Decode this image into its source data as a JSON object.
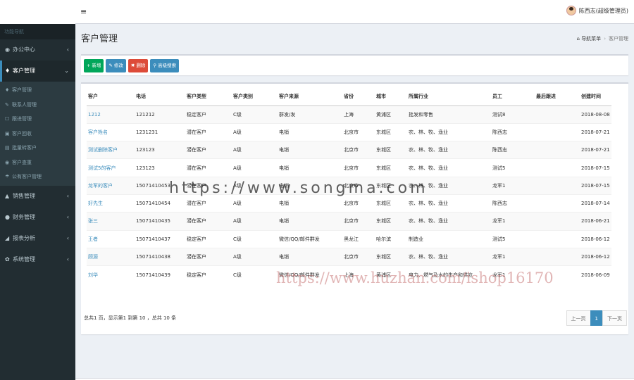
{
  "header": {
    "menu_toggle": "≡",
    "user_name": "陈西志(超级管理员)"
  },
  "sidebar": {
    "nav_header": "功能导航",
    "items": [
      {
        "icon": "◉",
        "label": "办公中心",
        "chevron": "‹"
      },
      {
        "icon": "♦",
        "label": "客户管理",
        "chevron": "⌄"
      },
      {
        "icon": "▲",
        "label": "销售管理",
        "chevron": "‹"
      },
      {
        "icon": "●",
        "label": "财务管理",
        "chevron": "‹"
      },
      {
        "icon": "◢",
        "label": "报表分析",
        "chevron": "‹"
      },
      {
        "icon": "✿",
        "label": "系统管理",
        "chevron": "‹"
      }
    ],
    "submenu": [
      {
        "icon": "♦",
        "label": "客户管理"
      },
      {
        "icon": "✎",
        "label": "联系人管理"
      },
      {
        "icon": "☐",
        "label": "跟进管理"
      },
      {
        "icon": "▣",
        "label": "客户回收"
      },
      {
        "icon": "▤",
        "label": "批量转客户"
      },
      {
        "icon": "◉",
        "label": "客户查重"
      },
      {
        "icon": "☂",
        "label": "公有客户管理"
      }
    ]
  },
  "page": {
    "title": "客户管理",
    "breadcrumb_home": "导航菜单",
    "breadcrumb_sep": "›",
    "breadcrumb_current": "客户管理"
  },
  "toolbar": {
    "add_label": "新增",
    "edit_label": "修改",
    "delete_label": "删除",
    "search_label": "高级搜索"
  },
  "table": {
    "headers": [
      "客户",
      "电话",
      "客户类型",
      "客户类别",
      "客户来源",
      "省份",
      "城市",
      "所属行业",
      "员工",
      "最后跟进",
      "创建时间"
    ],
    "rows": [
      [
        "1212",
        "121212",
        "稳定客户",
        "C级",
        "群发/发",
        "上海",
        "黄浦区",
        "批发和零售",
        "测试8",
        "",
        "2018-08-08"
      ],
      [
        "客户姓名",
        "1231231",
        "潜在客户",
        "A级",
        "电销",
        "北京市",
        "东城区",
        "农、林、牧、渔业",
        "陈西志",
        "",
        "2018-07-21"
      ],
      [
        "测试删除客户",
        "123123",
        "潜在客户",
        "A级",
        "电销",
        "北京市",
        "东城区",
        "农、林、牧、渔业",
        "陈西志",
        "",
        "2018-07-21"
      ],
      [
        "测试5的客户",
        "123123",
        "潜在客户",
        "A级",
        "电销",
        "北京市",
        "东城区",
        "农、林、牧、渔业",
        "测试5",
        "",
        "2018-07-15"
      ],
      [
        "龙军的客户",
        "15071410453",
        "潜在客户",
        "A级",
        "电销",
        "北京市",
        "东城区",
        "农、林、牧、渔业",
        "龙军1",
        "",
        "2018-07-15"
      ],
      [
        "好先生",
        "15071410454",
        "潜在客户",
        "A级",
        "电销",
        "北京市",
        "东城区",
        "农、林、牧、渔业",
        "陈西志",
        "",
        "2018-07-14"
      ],
      [
        "张三",
        "15071410435",
        "潜在客户",
        "A级",
        "电销",
        "北京市",
        "东城区",
        "农、林、牧、渔业",
        "龙军1",
        "",
        "2018-06-21"
      ],
      [
        "王者",
        "15071410437",
        "稳定客户",
        "C级",
        "微信/QQ/邮件群发",
        "黑龙江",
        "哈尔滨",
        "制造业",
        "测试5",
        "",
        "2018-06-12"
      ],
      [
        "顾源",
        "15071410438",
        "潜在客户",
        "A级",
        "电销",
        "北京市",
        "东城区",
        "农、林、牧、渔业",
        "龙军1",
        "",
        "2018-06-12"
      ],
      [
        "刘华",
        "15071410439",
        "稳定客户",
        "C级",
        "微信/QQ/邮件群发",
        "上海",
        "黄浦区",
        "电力、燃气及水的生产和供应",
        "龙军1",
        "",
        "2018-06-09"
      ]
    ]
  },
  "pagination": {
    "info": "总共1 页，显示第1 到第 10 ，总共 10 条",
    "prev": "上一页",
    "current": "1",
    "next": "下一页"
  },
  "watermarks": {
    "main": "https://www.songma.com",
    "secondary": "https://www.huzhan.com/ishop16170"
  }
}
